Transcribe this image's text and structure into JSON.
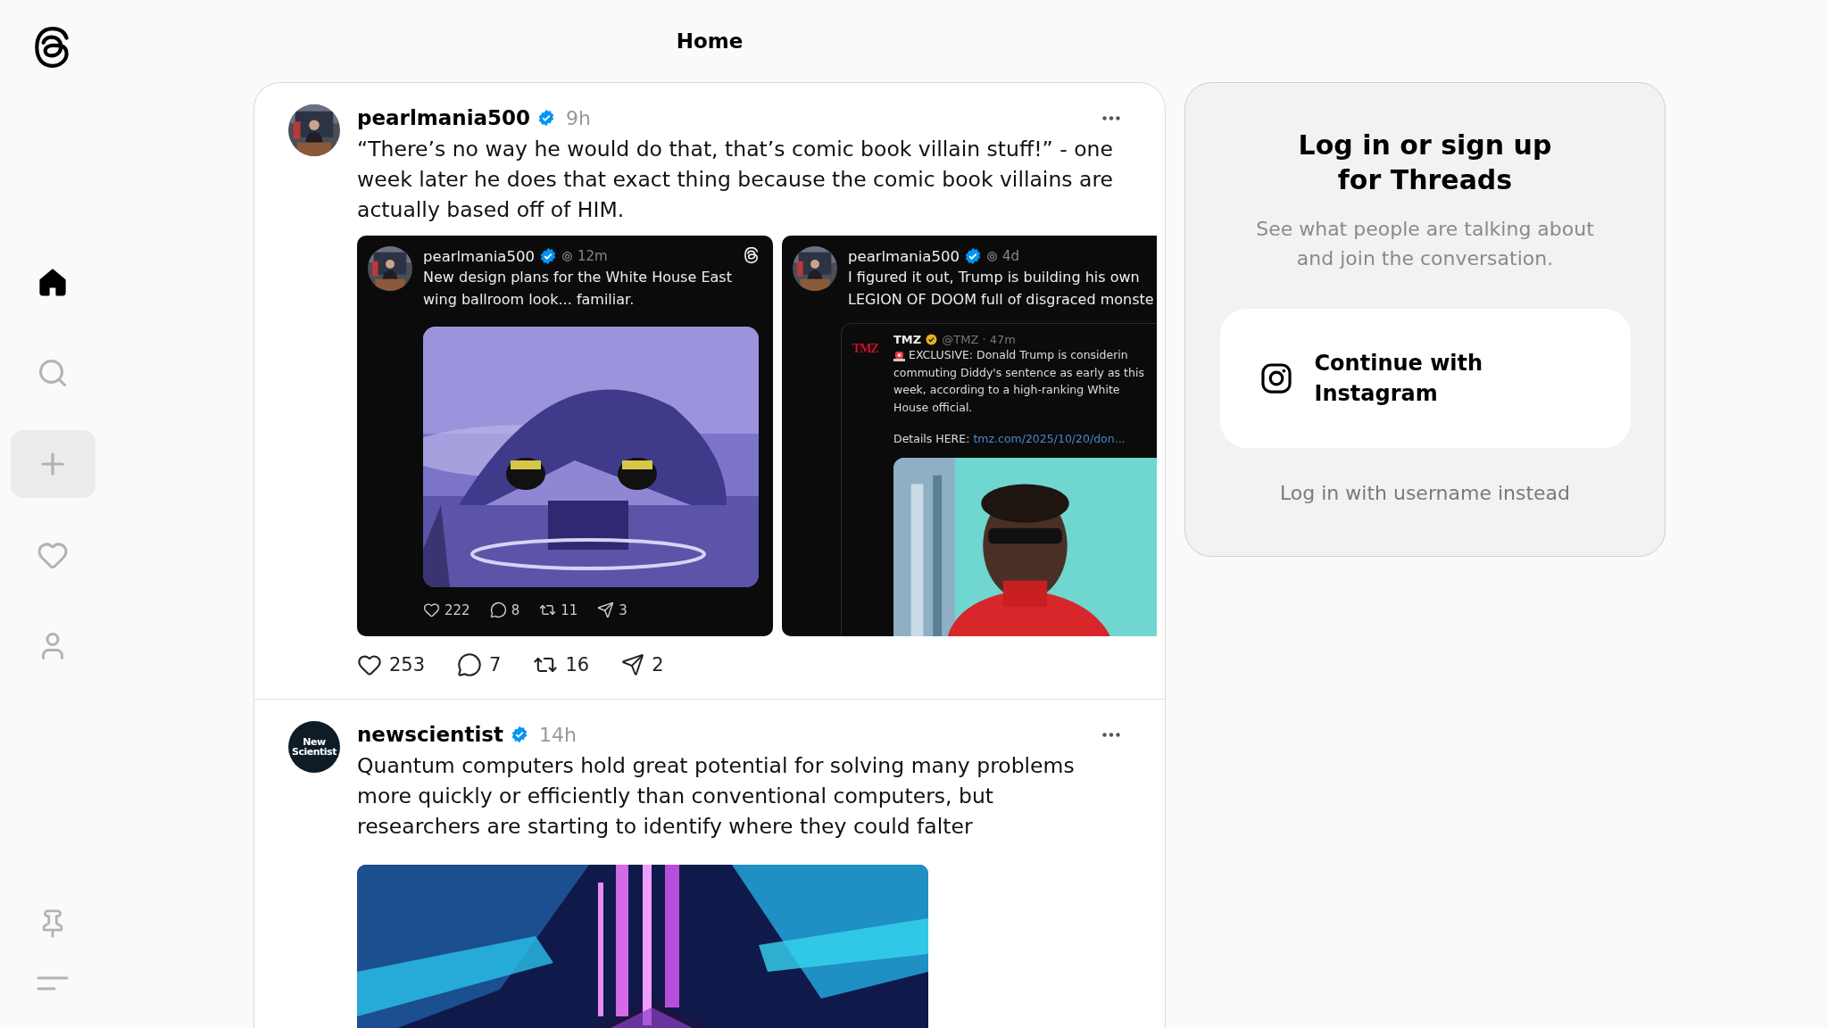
{
  "sidebar": {
    "items": [
      {
        "kind": "home",
        "selected": true
      },
      {
        "kind": "search",
        "selected": false
      },
      {
        "kind": "create",
        "selected": false
      },
      {
        "kind": "activity",
        "selected": false
      },
      {
        "kind": "profile",
        "selected": false
      }
    ],
    "bottom_items": [
      {
        "kind": "pin"
      },
      {
        "kind": "menu"
      }
    ]
  },
  "header": {
    "title": "Home"
  },
  "posts": [
    {
      "username": "pearlmania500",
      "verified": true,
      "time": "9h",
      "text": "“There’s no way he would do that, that’s comic book villain stuff!” - one week later he does that exact thing because the comic book villains are actually based off of HIM.",
      "attachments": [
        {
          "kind": "post",
          "username": "pearlmania500",
          "verified": true,
          "time": "12m",
          "lines": [
            "New design plans for the White House East",
            "wing ballroom look... familiar."
          ],
          "media": {
            "kind": "picture"
          },
          "stats": [
            "222",
            "8",
            "11",
            "3"
          ]
        },
        {
          "kind": "quote",
          "username": "pearlmania500",
          "verified": true,
          "time": "4d",
          "lines": [
            "I figured it out, Trump is building his own",
            "LEGION OF DOOM full of disgraced monste"
          ],
          "quoted": {
            "logo": "TMZ",
            "name": "TMZ",
            "handle": "@TMZ · 47m",
            "lines": [
              "EXCLUSIVE: Donald Trump is considerin",
              "commuting Diddy's sentence as early as this",
              "week, according to a high-ranking White",
              "House official."
            ],
            "details_label": "Details HERE:",
            "link": "tmz.com/2025/10/20/don...",
            "media": {
              "kind": "picture"
            }
          }
        }
      ],
      "stats": {
        "likes": "253",
        "replies": "7",
        "reposts": "16",
        "shares": "2"
      }
    },
    {
      "username": "newscientist",
      "verified": true,
      "time": "14h",
      "text": "Quantum computers hold great potential for solving many problems more quickly or efficiently than conventional computers, but researchers are starting to identify where they could falter",
      "avatar_label": [
        "New",
        "Scientist"
      ],
      "media": {
        "kind": "picture"
      }
    }
  ],
  "login_panel": {
    "title_lines": [
      "Log in or sign up",
      "for Threads"
    ],
    "subtitle_lines": [
      "See what people are talking about",
      "and join the conversation."
    ],
    "button_lines": [
      "Continue with",
      "Instagram"
    ],
    "alt_link": "Log in with username instead"
  }
}
